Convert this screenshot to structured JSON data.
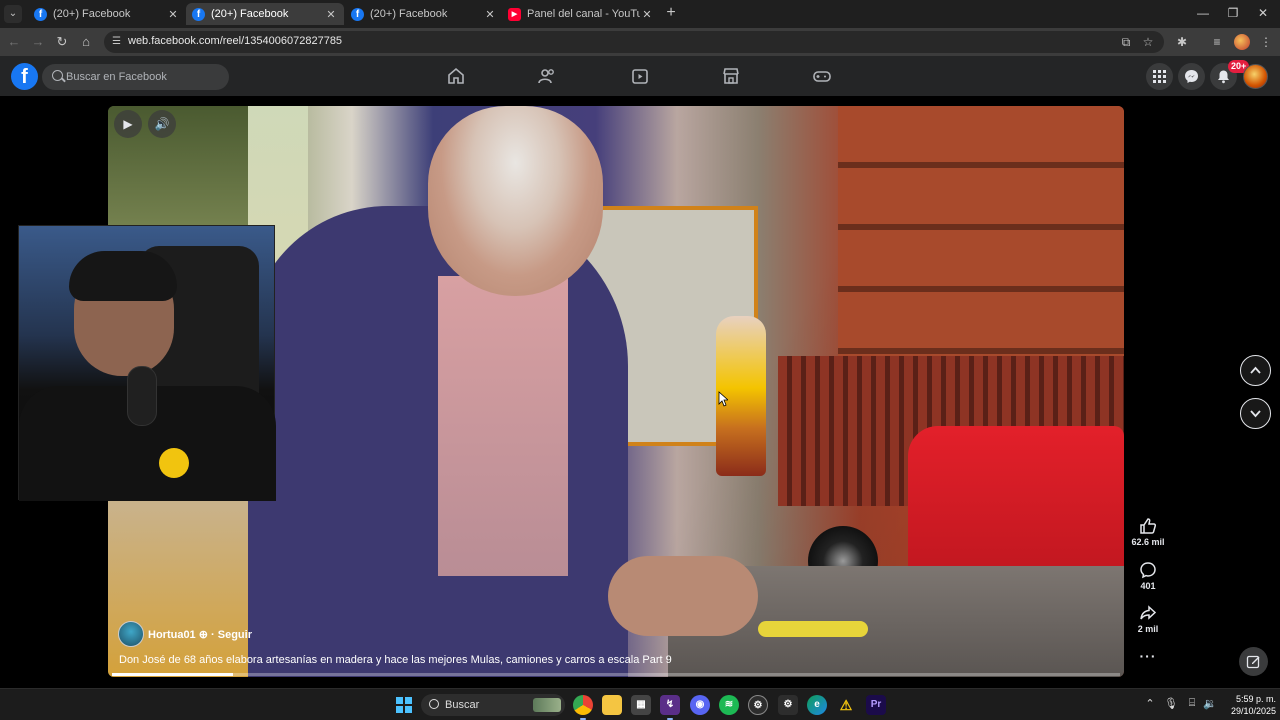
{
  "browser": {
    "tabs": [
      {
        "title": "(20+) Facebook",
        "favicon": "facebook-icon",
        "active": false
      },
      {
        "title": "(20+) Facebook",
        "favicon": "facebook-icon",
        "active": true
      },
      {
        "title": "(20+) Facebook",
        "favicon": "facebook-icon",
        "active": false
      },
      {
        "title": "Panel del canal - YouTube Studi",
        "favicon": "youtube-icon",
        "active": false
      }
    ],
    "url": "web.facebook.com/reel/1354006072827785"
  },
  "facebook": {
    "search_placeholder": "Buscar en Facebook",
    "notifications_badge": "20+",
    "brand_color": "#1877f2"
  },
  "reel": {
    "author": "Hortua01",
    "follow_label": "· Seguir",
    "caption": "Don José de 68 años elabora artesanías en madera y hace las mejores Mulas, camiones y carros a escala Part 9",
    "likes": "62.6 mil",
    "comments": "401",
    "shares": "2 mil",
    "progress_fraction": 0.12
  },
  "taskbar": {
    "search_label": "Buscar",
    "time": "5:59 p. m.",
    "date": "29/10/2025"
  }
}
